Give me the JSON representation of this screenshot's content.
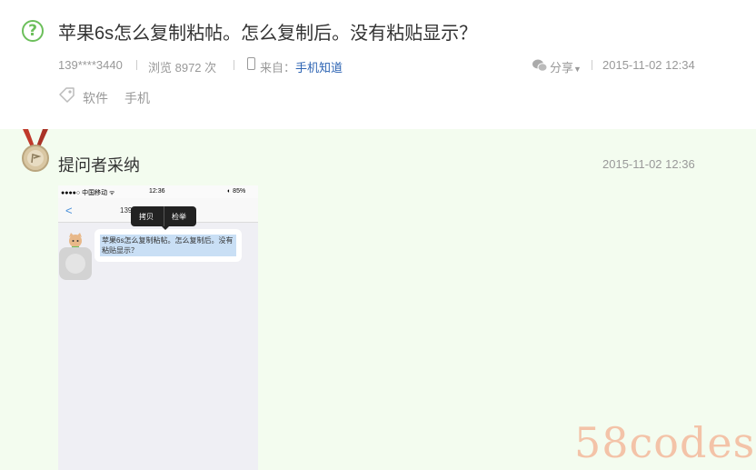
{
  "question": {
    "icon": "question-circle-icon",
    "mark": "?",
    "title": "苹果6s怎么复制粘帖。怎么复制后。没有粘贴显示？",
    "user": "139****3440",
    "views": "浏览 8972 次",
    "source_prefix": "来自：",
    "source": "手机知道",
    "share_label": "分享",
    "time": "2015-11-02 12:34",
    "tags": [
      "软件",
      "手机"
    ]
  },
  "answer": {
    "title": "提问者采纳",
    "time": "2015-11-02 12:36",
    "screenshot": {
      "status_left": "●●●●○ 中国移动 ᯤ",
      "status_time": "12:36",
      "status_right": "◐ 85%",
      "nav_title": "139",
      "menu_copy": "拷贝",
      "menu_report": "检举",
      "bubble_text": "苹果6s怎么复制粘帖。怎么复制后。没有粘贴显示？"
    }
  },
  "watermark": "58codes",
  "colors": {
    "accent_green": "#6cbf5b",
    "link_blue": "#2d64b3",
    "answer_bg": "#f3fcef"
  }
}
